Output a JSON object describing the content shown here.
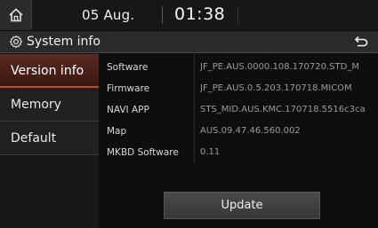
{
  "status_bar": {
    "date": "05 Aug.",
    "time": "01:38"
  },
  "header": {
    "title": "System info"
  },
  "sidebar": {
    "items": [
      {
        "label": "Version info",
        "active": true
      },
      {
        "label": "Memory",
        "active": false
      },
      {
        "label": "Default",
        "active": false
      }
    ]
  },
  "info_rows": [
    {
      "label": "Software",
      "value": "JF_PE.AUS.0000.108.170720.STD_M"
    },
    {
      "label": "Firmware",
      "value": "JF_PE.AUS.0.5.203.170718.MICOM"
    },
    {
      "label": "NAVI APP",
      "value": "STS_MID.AUS.KMC.170718.5516c3ca"
    },
    {
      "label": "Map",
      "value": "AUS.09.47.46.560.002"
    },
    {
      "label": "MKBD Software",
      "value": "0.11"
    }
  ],
  "update_button": {
    "label": "Update"
  },
  "colors": {
    "active_tab": "#5a2a1e",
    "accent_underline": "#c14a2a"
  },
  "icons": {
    "home": "home-icon",
    "settings": "gear-icon",
    "back": "back-arrow-icon"
  }
}
